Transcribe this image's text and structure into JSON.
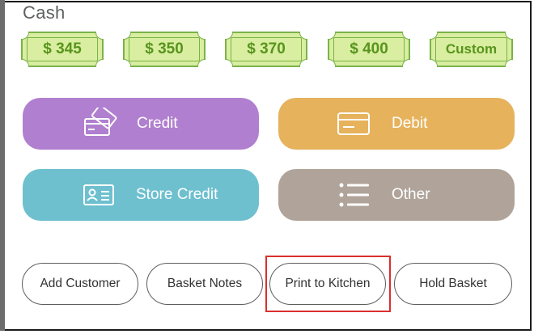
{
  "section_title": "Cash",
  "quick_cash": [
    {
      "label": "$ 345"
    },
    {
      "label": "$ 350"
    },
    {
      "label": "$ 370"
    },
    {
      "label": "$ 400"
    },
    {
      "label": "Custom"
    }
  ],
  "payment_methods": {
    "credit": {
      "label": "Credit",
      "icon": "credit-card-icon",
      "color": "#b07fcf"
    },
    "debit": {
      "label": "Debit",
      "icon": "debit-card-icon",
      "color": "#e6b25c"
    },
    "store_credit": {
      "label": "Store Credit",
      "icon": "id-card-icon",
      "color": "#6ec0cf"
    },
    "other": {
      "label": "Other",
      "icon": "list-icon",
      "color": "#b0a49a"
    }
  },
  "actions": {
    "add_customer": "Add Customer",
    "basket_notes": "Basket Notes",
    "print_to_kitchen": "Print to Kitchen",
    "hold_basket": "Hold Basket"
  },
  "colors": {
    "cash_bill_fill": "#d9eea0",
    "cash_bill_text": "#58941e",
    "highlight": "#d9302d"
  }
}
